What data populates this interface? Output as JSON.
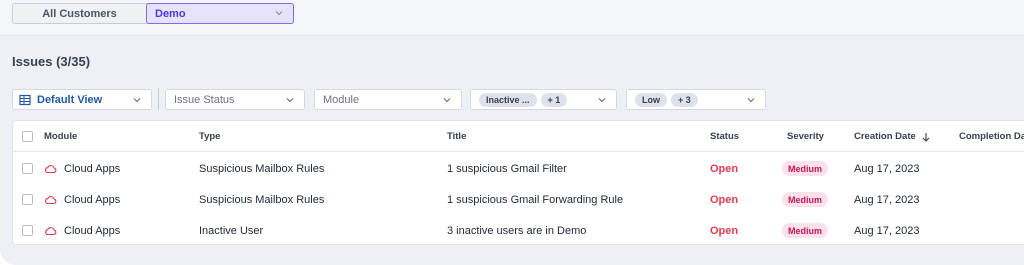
{
  "scope": {
    "all_customers": "All Customers",
    "selected": "Demo"
  },
  "issues": {
    "title": "Issues (3/35)"
  },
  "filters": {
    "view": "Default View",
    "status_placeholder": "Issue Status",
    "module_placeholder": "Module",
    "type_chip": "Inactive ...",
    "type_more": "+ 1",
    "severity_chip": "Low",
    "severity_more": "+ 3"
  },
  "table": {
    "columns": {
      "module": "Module",
      "type": "Type",
      "title": "Title",
      "status": "Status",
      "severity": "Severity",
      "creation_date": "Creation Date",
      "completion_date": "Completion Date"
    },
    "rows": [
      {
        "module": "Cloud Apps",
        "type": "Suspicious Mailbox Rules",
        "title": "1 suspicious Gmail Filter",
        "status": "Open",
        "severity": "Medium",
        "creation_date": "Aug 17, 2023"
      },
      {
        "module": "Cloud Apps",
        "type": "Suspicious Mailbox Rules",
        "title": "1 suspicious Gmail Forwarding Rule",
        "status": "Open",
        "severity": "Medium",
        "creation_date": "Aug 17, 2023"
      },
      {
        "module": "Cloud Apps",
        "type": "Inactive User",
        "title": "3 inactive users are in Demo",
        "status": "Open",
        "severity": "Medium",
        "creation_date": "Aug 17, 2023"
      }
    ]
  },
  "icons": {
    "module_icon": "cloud-icon",
    "sort_icon": "arrow-down-icon",
    "dropdown_icon": "chevron-down-icon",
    "view_icon": "table-grid-icon"
  },
  "colors": {
    "accent": "#7c6cf2",
    "status_open": "#e23b4e",
    "severity_medium_bg": "#fde1ea",
    "severity_medium_text": "#c2185b",
    "link_blue": "#1e5aa8"
  }
}
